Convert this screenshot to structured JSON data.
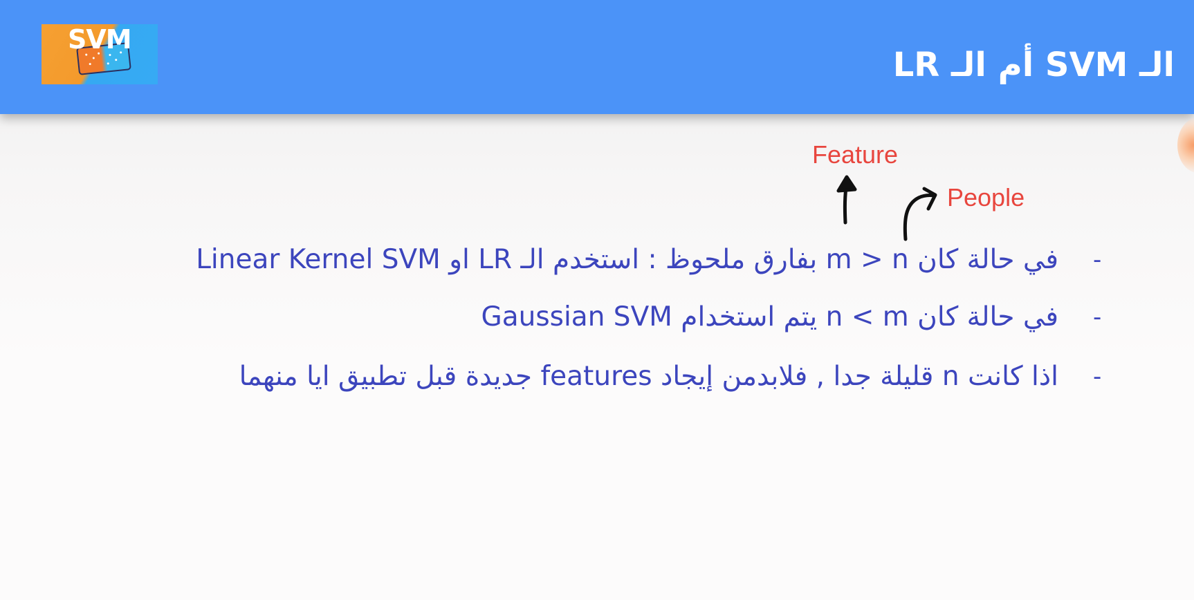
{
  "logo": {
    "text": "SVM",
    "colors": [
      "#f6a032",
      "#35a9f2"
    ]
  },
  "header": {
    "title": "الـ  SVM أم الـ  LR",
    "background_color": "#4b93f8"
  },
  "annotations": {
    "feature_label": "Feature",
    "people_label": "People",
    "color": "#e8463e"
  },
  "bullets": {
    "marker": "-",
    "items": [
      {
        "text": "في حالة كان  m > n بفارق ملحوظ : استخدم الـ  LR او Linear Kernel SVM"
      },
      {
        "text": "في حالة كان   n < m يتم استخدام Gaussian SVM"
      },
      {
        "text": "اذا كانت  n قليلة جدا , فلابدمن إيجاد  features جديدة قبل تطبيق ايا منهما"
      }
    ],
    "color": "#3c45bd"
  }
}
